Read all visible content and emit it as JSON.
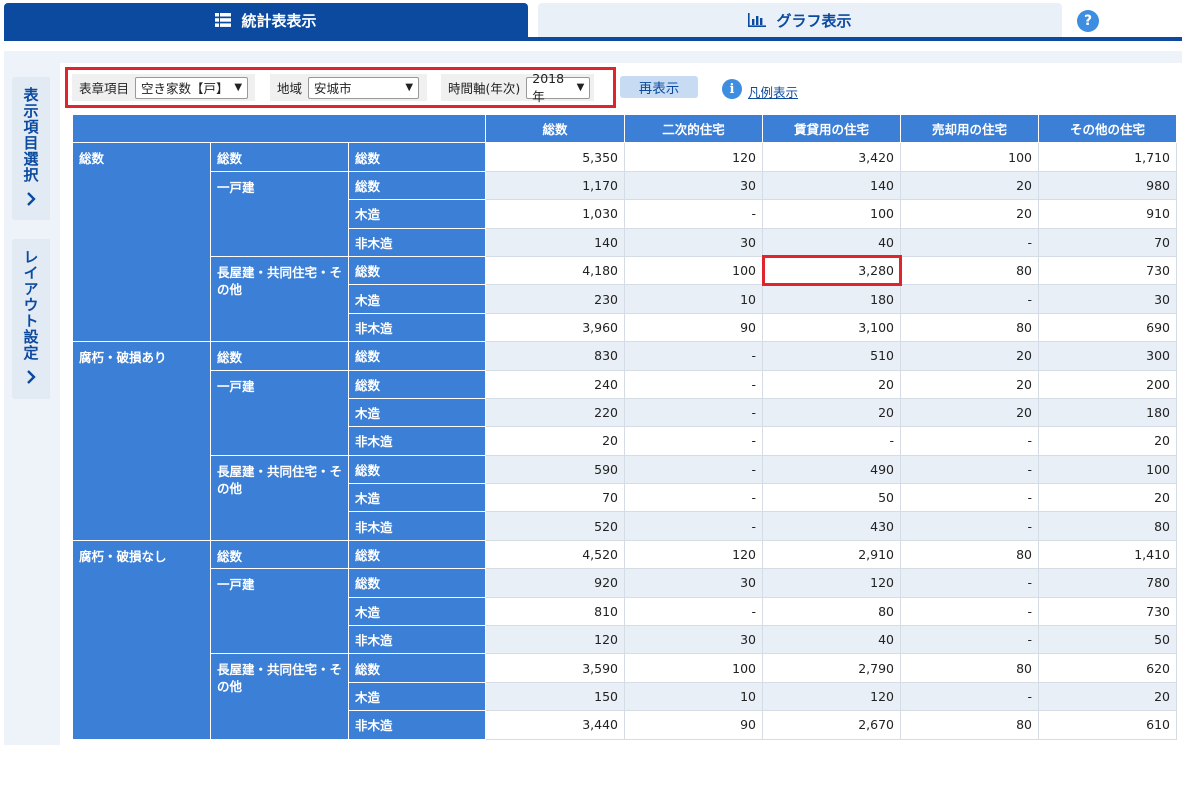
{
  "tabs": {
    "table_label": "統計表表示",
    "graph_label": "グラフ表示",
    "help": "?"
  },
  "side": {
    "item_select": "表示項目選択",
    "layout": "レイアウト設定",
    "chevron": "›"
  },
  "controls": {
    "item_label": "表章項目",
    "item_value": "空き家数【戸】",
    "region_label": "地域",
    "region_value": "安城市",
    "time_label": "時間軸(年次)",
    "time_value": "2018年",
    "redisplay": "再表示",
    "legend": "凡例表示",
    "info": "i"
  },
  "table": {
    "columns": [
      "総数",
      "二次的住宅",
      "賃貸用の住宅",
      "売却用の住宅",
      "その他の住宅"
    ],
    "groups": [
      {
        "label": "総数",
        "subgroups": [
          {
            "label": "総数",
            "rows": [
              {
                "label": "総数",
                "values": [
                  "5,350",
                  "120",
                  "3,420",
                  "100",
                  "1,710"
                ]
              }
            ]
          },
          {
            "label": "一戸建",
            "rows": [
              {
                "label": "総数",
                "values": [
                  "1,170",
                  "30",
                  "140",
                  "20",
                  "980"
                ]
              },
              {
                "label": "木造",
                "values": [
                  "1,030",
                  "-",
                  "100",
                  "20",
                  "910"
                ]
              },
              {
                "label": "非木造",
                "values": [
                  "140",
                  "30",
                  "40",
                  "-",
                  "70"
                ]
              }
            ]
          },
          {
            "label": "長屋建・共同住宅・その他",
            "rows": [
              {
                "label": "総数",
                "values": [
                  "4,180",
                  "100",
                  "3,280",
                  "80",
                  "730"
                ]
              },
              {
                "label": "木造",
                "values": [
                  "230",
                  "10",
                  "180",
                  "-",
                  "30"
                ]
              },
              {
                "label": "非木造",
                "values": [
                  "3,960",
                  "90",
                  "3,100",
                  "80",
                  "690"
                ]
              }
            ]
          }
        ]
      },
      {
        "label": "腐朽・破損あり",
        "subgroups": [
          {
            "label": "総数",
            "rows": [
              {
                "label": "総数",
                "values": [
                  "830",
                  "-",
                  "510",
                  "20",
                  "300"
                ]
              }
            ]
          },
          {
            "label": "一戸建",
            "rows": [
              {
                "label": "総数",
                "values": [
                  "240",
                  "-",
                  "20",
                  "20",
                  "200"
                ]
              },
              {
                "label": "木造",
                "values": [
                  "220",
                  "-",
                  "20",
                  "20",
                  "180"
                ]
              },
              {
                "label": "非木造",
                "values": [
                  "20",
                  "-",
                  "-",
                  "-",
                  "20"
                ]
              }
            ]
          },
          {
            "label": "長屋建・共同住宅・その他",
            "rows": [
              {
                "label": "総数",
                "values": [
                  "590",
                  "-",
                  "490",
                  "-",
                  "100"
                ]
              },
              {
                "label": "木造",
                "values": [
                  "70",
                  "-",
                  "50",
                  "-",
                  "20"
                ]
              },
              {
                "label": "非木造",
                "values": [
                  "520",
                  "-",
                  "430",
                  "-",
                  "80"
                ]
              }
            ]
          }
        ]
      },
      {
        "label": "腐朽・破損なし",
        "subgroups": [
          {
            "label": "総数",
            "rows": [
              {
                "label": "総数",
                "values": [
                  "4,520",
                  "120",
                  "2,910",
                  "80",
                  "1,410"
                ]
              }
            ]
          },
          {
            "label": "一戸建",
            "rows": [
              {
                "label": "総数",
                "values": [
                  "920",
                  "30",
                  "120",
                  "-",
                  "780"
                ]
              },
              {
                "label": "木造",
                "values": [
                  "810",
                  "-",
                  "80",
                  "-",
                  "730"
                ]
              },
              {
                "label": "非木造",
                "values": [
                  "120",
                  "30",
                  "40",
                  "-",
                  "50"
                ]
              }
            ]
          },
          {
            "label": "長屋建・共同住宅・その他",
            "rows": [
              {
                "label": "総数",
                "values": [
                  "3,590",
                  "100",
                  "2,790",
                  "80",
                  "620"
                ]
              },
              {
                "label": "木造",
                "values": [
                  "150",
                  "10",
                  "120",
                  "-",
                  "20"
                ]
              },
              {
                "label": "非木造",
                "values": [
                  "3,440",
                  "90",
                  "2,670",
                  "80",
                  "610"
                ]
              }
            ]
          }
        ]
      }
    ]
  }
}
